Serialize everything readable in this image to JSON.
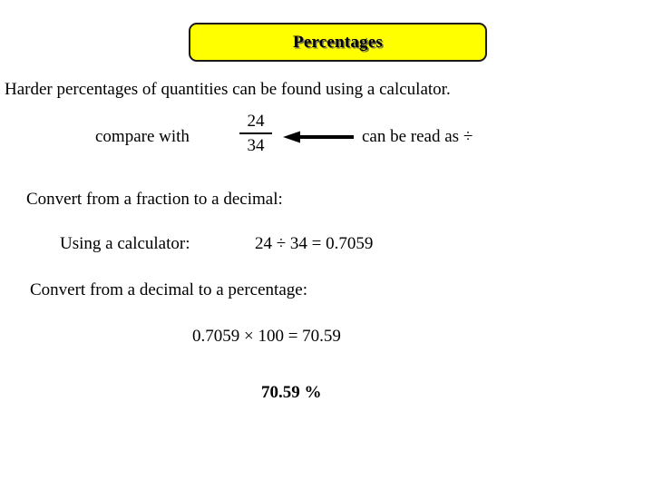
{
  "slide": {
    "background_color": "#ffffff",
    "title": {
      "text": "Percentages",
      "fill_color": "#ffff00",
      "border_color": "#1a1a1a",
      "text_color": "#000000"
    },
    "body": {
      "intro": "Harder percentages of quantities can be found using a calculator.",
      "compare_label": "compare with",
      "fraction": {
        "numerator": "24",
        "denominator": "34"
      },
      "arrow": {
        "direction": "left",
        "name": "left-arrow"
      },
      "read_as": "can be read as ÷",
      "step1_heading": "Convert from a fraction to a decimal:",
      "step1_label": "Using a calculator:",
      "step1_calculation": "24 ÷ 34 = 0.7059",
      "step2_heading": "Convert from a decimal to a percentage:",
      "step2_calculation": "0.7059 × 100 = 70.59",
      "answer": "70.59 %"
    }
  }
}
